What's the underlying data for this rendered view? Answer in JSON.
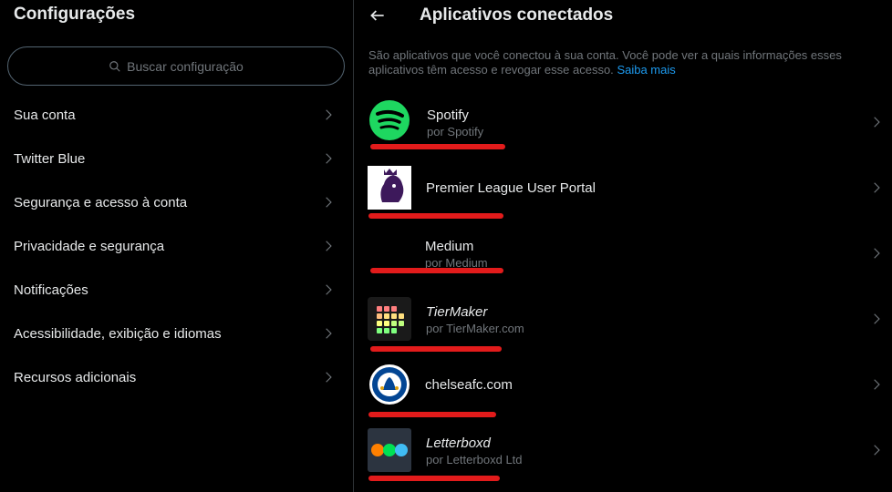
{
  "settings": {
    "title": "Configurações",
    "search_placeholder": "Buscar configuração",
    "menu": [
      {
        "label": "Sua conta"
      },
      {
        "label": "Twitter Blue"
      },
      {
        "label": "Segurança e acesso à conta"
      },
      {
        "label": "Privacidade e segurança"
      },
      {
        "label": "Notificações"
      },
      {
        "label": "Acessibilidade, exibição e idiomas"
      },
      {
        "label": "Recursos adicionais"
      }
    ]
  },
  "connected_apps": {
    "title": "Aplicativos conectados",
    "description": "São aplicativos que você conectou à sua conta. Você pode ver a quais informações esses aplicativos têm acesso e revogar esse acesso.",
    "learn_more": "Saiba mais",
    "apps": [
      {
        "name": "Spotify",
        "publisher": "por Spotify",
        "icon": "spotify-icon"
      },
      {
        "name": "Premier League User Portal",
        "publisher": "",
        "icon": "premier-league-icon"
      },
      {
        "name": "Medium",
        "publisher": "por Medium",
        "icon": "medium-icon"
      },
      {
        "name": "TierMaker",
        "publisher": "por TierMaker.com",
        "icon": "tiermaker-icon"
      },
      {
        "name": "chelseafc.com",
        "publisher": "",
        "icon": "chelsea-icon"
      },
      {
        "name": "Letterboxd",
        "publisher": "por Letterboxd Ltd",
        "icon": "letterboxd-icon"
      }
    ]
  },
  "colors": {
    "background": "#000000",
    "text": "#e7e9ea",
    "muted": "#71767b",
    "link": "#1d9bf0",
    "redaction": "#e21b1b",
    "spotify": "#1ed760"
  }
}
